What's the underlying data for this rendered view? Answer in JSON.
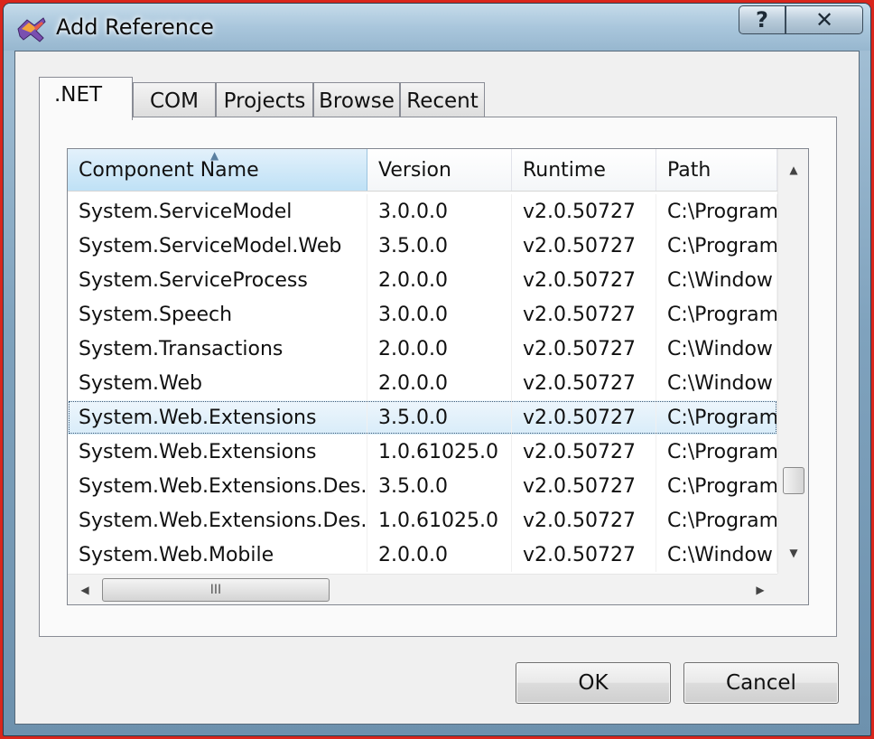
{
  "window": {
    "title": "Add Reference",
    "help_label": "?",
    "close_label": "✕"
  },
  "tabs": [
    {
      "label": ".NET",
      "active": true
    },
    {
      "label": "COM",
      "active": false
    },
    {
      "label": "Projects",
      "active": false
    },
    {
      "label": "Browse",
      "active": false
    },
    {
      "label": "Recent",
      "active": false
    }
  ],
  "list": {
    "columns": [
      "Component Name",
      "Version",
      "Runtime",
      "Path"
    ],
    "sorted_column": "Component Name",
    "rows": [
      {
        "name": "System.ServiceModel",
        "version": "3.0.0.0",
        "runtime": "v2.0.50727",
        "path": "C:\\Program"
      },
      {
        "name": "System.ServiceModel.Web",
        "version": "3.5.0.0",
        "runtime": "v2.0.50727",
        "path": "C:\\Program"
      },
      {
        "name": "System.ServiceProcess",
        "version": "2.0.0.0",
        "runtime": "v2.0.50727",
        "path": "C:\\Window"
      },
      {
        "name": "System.Speech",
        "version": "3.0.0.0",
        "runtime": "v2.0.50727",
        "path": "C:\\Program"
      },
      {
        "name": "System.Transactions",
        "version": "2.0.0.0",
        "runtime": "v2.0.50727",
        "path": "C:\\Window"
      },
      {
        "name": "System.Web",
        "version": "2.0.0.0",
        "runtime": "v2.0.50727",
        "path": "C:\\Window"
      },
      {
        "name": "System.Web.Extensions",
        "version": "3.5.0.0",
        "runtime": "v2.0.50727",
        "path": "C:\\Program",
        "selected": true
      },
      {
        "name": "System.Web.Extensions",
        "version": "1.0.61025.0",
        "runtime": "v2.0.50727",
        "path": "C:\\Program"
      },
      {
        "name": "System.Web.Extensions.Des...",
        "version": "3.5.0.0",
        "runtime": "v2.0.50727",
        "path": "C:\\Program"
      },
      {
        "name": "System.Web.Extensions.Des...",
        "version": "1.0.61025.0",
        "runtime": "v2.0.50727",
        "path": "C:\\Program"
      },
      {
        "name": "System.Web.Mobile",
        "version": "2.0.0.0",
        "runtime": "v2.0.50727",
        "path": "C:\\Window"
      }
    ],
    "hscroll_grip": "III"
  },
  "buttons": {
    "ok": "OK",
    "cancel": "Cancel"
  },
  "icons": {
    "app": "visual-studio-icon",
    "help": "help-icon",
    "close": "close-icon"
  },
  "colors": {
    "frame_border": "#d9261c",
    "selection": "#d8ecf9"
  }
}
